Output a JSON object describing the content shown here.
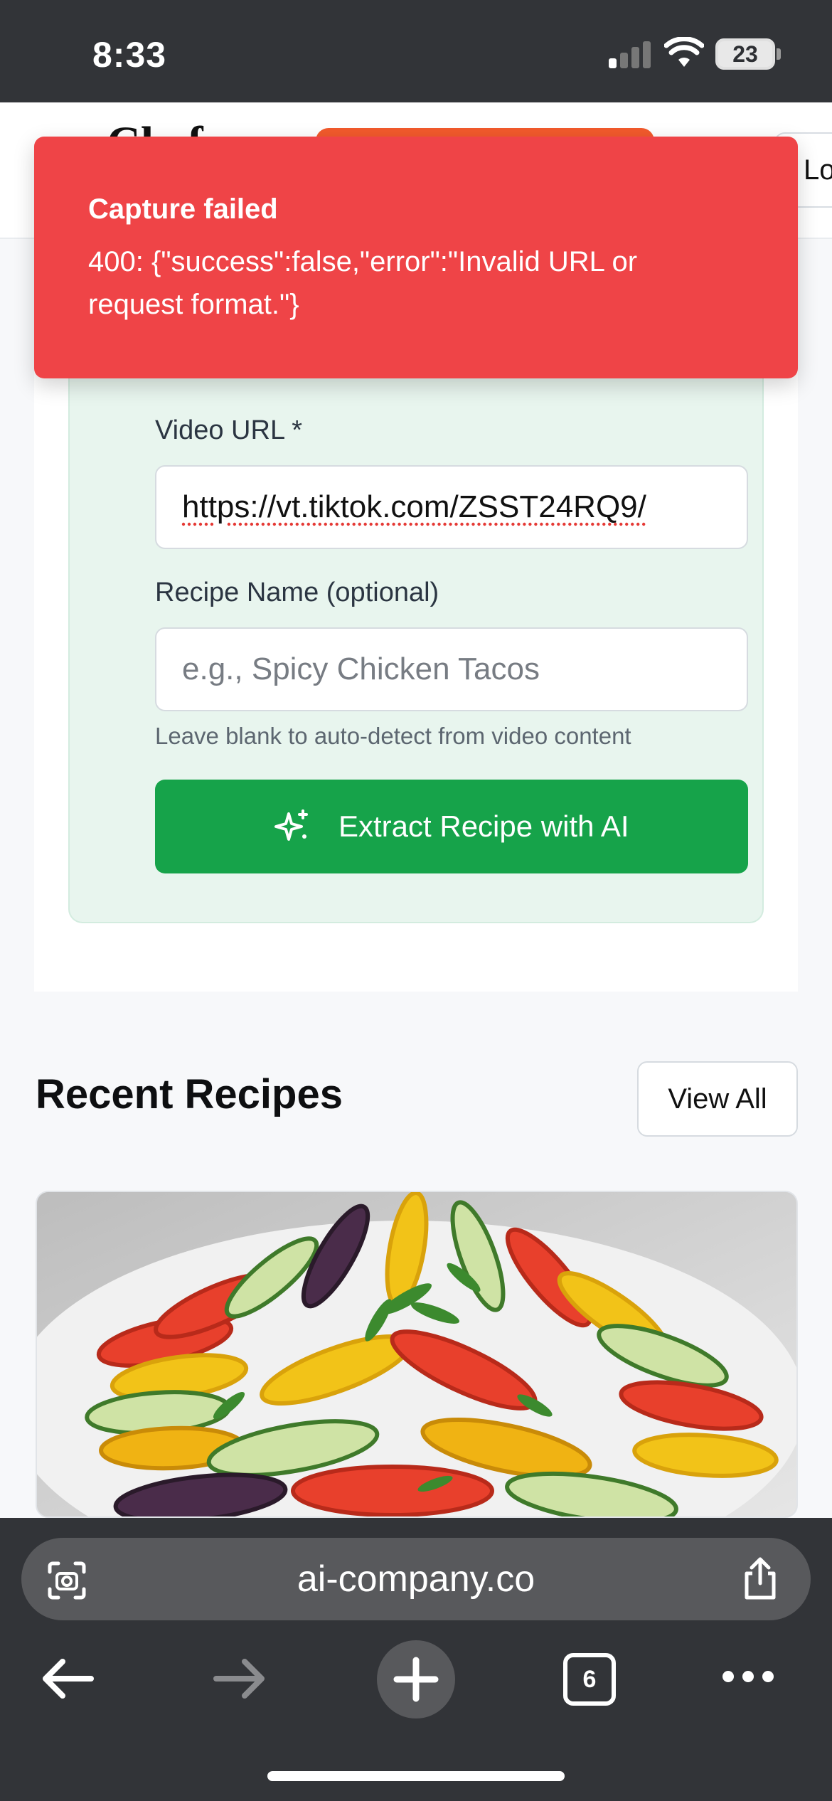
{
  "status_bar": {
    "time": "8:33",
    "battery_level": "23",
    "signal_bars_active": 1,
    "signal_bars_total": 4
  },
  "header": {
    "brand_text": "Chef",
    "login_label": "Lo",
    "cta_color": "#f25a2c"
  },
  "toast": {
    "title": "Capture failed",
    "message": "400: {\"success\":false,\"error\":\"Invalid URL or request format.\"}",
    "color": "#ef4447"
  },
  "form": {
    "video_url_label": "Video URL *",
    "video_url_value": "https://vt.tiktok.com/ZSST24RQ9/",
    "recipe_name_label": "Recipe Name (optional)",
    "recipe_name_placeholder": "e.g., Spicy Chicken Tacos",
    "recipe_name_hint": "Leave blank to auto-detect from video content",
    "extract_button_label": "Extract Recipe with AI",
    "extract_button_icon": "sparkles-icon",
    "accent_color": "#16a34a"
  },
  "recent": {
    "title": "Recent Recipes",
    "view_all_label": "View All",
    "first_card_image": "ratatouille-photo"
  },
  "browser": {
    "url": "ai-company.co",
    "tab_count": "6",
    "icons": [
      "scan-icon",
      "share-icon",
      "back-icon",
      "forward-icon",
      "new-tab-icon",
      "tabs-icon",
      "more-icon"
    ]
  }
}
